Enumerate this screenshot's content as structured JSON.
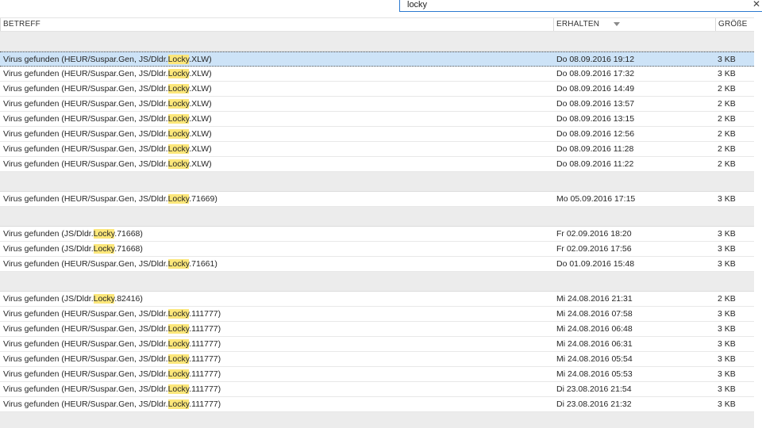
{
  "search": {
    "value": "locky",
    "clear_glyph": "✕"
  },
  "columns": {
    "subject": "BETREFF",
    "received": "ERHALTEN",
    "size": "GRÖßE"
  },
  "highlight_term": "Locky",
  "colors": {
    "highlight": "#fce77a",
    "selected_row": "#cde3f7",
    "group_separator": "#ececec",
    "search_border": "#2b79d0"
  },
  "groups": [
    {
      "rows": [
        {
          "subject_pre": "Virus gefunden (HEUR/Suspar.Gen, JS/Dldr.",
          "subject_hl": "Locky",
          "subject_post": ".XLW)",
          "received": "Do 08.09.2016 19:12",
          "size": "3 KB",
          "selected": true
        },
        {
          "subject_pre": "Virus gefunden (HEUR/Suspar.Gen, JS/Dldr.",
          "subject_hl": "Locky",
          "subject_post": ".XLW)",
          "received": "Do 08.09.2016 17:32",
          "size": "3 KB"
        },
        {
          "subject_pre": "Virus gefunden (HEUR/Suspar.Gen, JS/Dldr.",
          "subject_hl": "Locky",
          "subject_post": ".XLW)",
          "received": "Do 08.09.2016 14:49",
          "size": "2 KB"
        },
        {
          "subject_pre": "Virus gefunden (HEUR/Suspar.Gen, JS/Dldr.",
          "subject_hl": "Locky",
          "subject_post": ".XLW)",
          "received": "Do 08.09.2016 13:57",
          "size": "2 KB"
        },
        {
          "subject_pre": "Virus gefunden (HEUR/Suspar.Gen, JS/Dldr.",
          "subject_hl": "Locky",
          "subject_post": ".XLW)",
          "received": "Do 08.09.2016 13:15",
          "size": "2 KB"
        },
        {
          "subject_pre": "Virus gefunden (HEUR/Suspar.Gen, JS/Dldr.",
          "subject_hl": "Locky",
          "subject_post": ".XLW)",
          "received": "Do 08.09.2016 12:56",
          "size": "2 KB"
        },
        {
          "subject_pre": "Virus gefunden (HEUR/Suspar.Gen, JS/Dldr.",
          "subject_hl": "Locky",
          "subject_post": ".XLW)",
          "received": "Do 08.09.2016 11:28",
          "size": "2 KB"
        },
        {
          "subject_pre": "Virus gefunden (HEUR/Suspar.Gen, JS/Dldr.",
          "subject_hl": "Locky",
          "subject_post": ".XLW)",
          "received": "Do 08.09.2016 11:22",
          "size": "2 KB"
        }
      ]
    },
    {
      "rows": [
        {
          "subject_pre": "Virus gefunden (HEUR/Suspar.Gen, JS/Dldr.",
          "subject_hl": "Locky",
          "subject_post": ".71669)",
          "received": "Mo 05.09.2016 17:15",
          "size": "3 KB"
        }
      ]
    },
    {
      "rows": [
        {
          "subject_pre": "Virus gefunden (JS/Dldr.",
          "subject_hl": "Locky",
          "subject_post": ".71668)",
          "received": "Fr 02.09.2016 18:20",
          "size": "3 KB"
        },
        {
          "subject_pre": "Virus gefunden (JS/Dldr.",
          "subject_hl": "Locky",
          "subject_post": ".71668)",
          "received": "Fr 02.09.2016 17:56",
          "size": "3 KB"
        },
        {
          "subject_pre": "Virus gefunden (HEUR/Suspar.Gen, JS/Dldr.",
          "subject_hl": "Locky",
          "subject_post": ".71661)",
          "received": "Do 01.09.2016 15:48",
          "size": "3 KB"
        }
      ]
    },
    {
      "rows": [
        {
          "subject_pre": "Virus gefunden (JS/Dldr.",
          "subject_hl": "Locky",
          "subject_post": ".82416)",
          "received": "Mi 24.08.2016 21:31",
          "size": "2 KB"
        },
        {
          "subject_pre": "Virus gefunden (HEUR/Suspar.Gen, JS/Dldr.",
          "subject_hl": "Locky",
          "subject_post": ".111777)",
          "received": "Mi 24.08.2016 07:58",
          "size": "3 KB"
        },
        {
          "subject_pre": "Virus gefunden (HEUR/Suspar.Gen, JS/Dldr.",
          "subject_hl": "Locky",
          "subject_post": ".111777)",
          "received": "Mi 24.08.2016 06:48",
          "size": "3 KB"
        },
        {
          "subject_pre": "Virus gefunden (HEUR/Suspar.Gen, JS/Dldr.",
          "subject_hl": "Locky",
          "subject_post": ".111777)",
          "received": "Mi 24.08.2016 06:31",
          "size": "3 KB"
        },
        {
          "subject_pre": "Virus gefunden (HEUR/Suspar.Gen, JS/Dldr.",
          "subject_hl": "Locky",
          "subject_post": ".111777)",
          "received": "Mi 24.08.2016 05:54",
          "size": "3 KB"
        },
        {
          "subject_pre": "Virus gefunden (HEUR/Suspar.Gen, JS/Dldr.",
          "subject_hl": "Locky",
          "subject_post": ".111777)",
          "received": "Mi 24.08.2016 05:53",
          "size": "3 KB"
        },
        {
          "subject_pre": "Virus gefunden (HEUR/Suspar.Gen, JS/Dldr.",
          "subject_hl": "Locky",
          "subject_post": ".111777)",
          "received": "Di 23.08.2016 21:54",
          "size": "3 KB"
        },
        {
          "subject_pre": "Virus gefunden (HEUR/Suspar.Gen, JS/Dldr.",
          "subject_hl": "Locky",
          "subject_post": ".111777)",
          "received": "Di 23.08.2016 21:32",
          "size": "3 KB"
        }
      ]
    }
  ]
}
